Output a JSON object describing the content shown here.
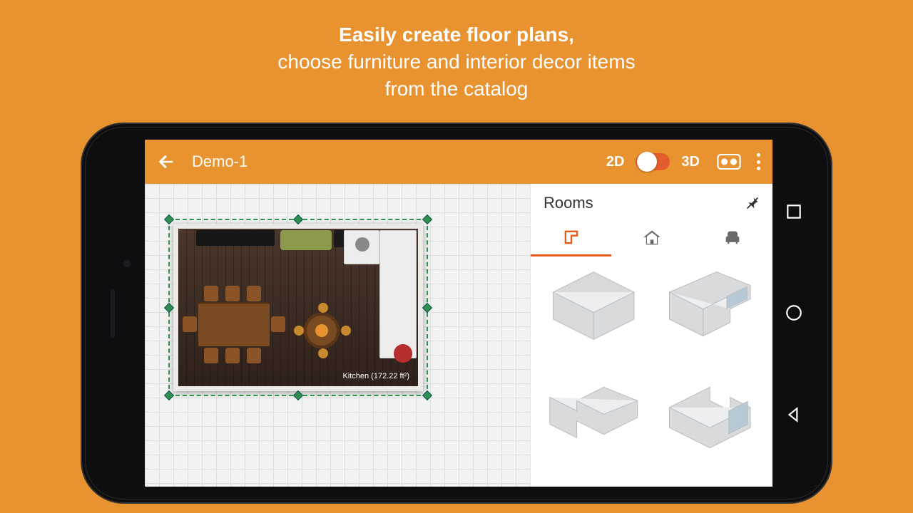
{
  "headline": {
    "bold": "Easily create floor plans,",
    "line2": "choose furniture and interior decor items",
    "line3": "from the catalog"
  },
  "appbar": {
    "title": "Demo-1",
    "mode2d": "2D",
    "mode3d": "3D"
  },
  "panel": {
    "title": "Rooms"
  },
  "room": {
    "label": "Kitchen (172.22 ft²)"
  }
}
